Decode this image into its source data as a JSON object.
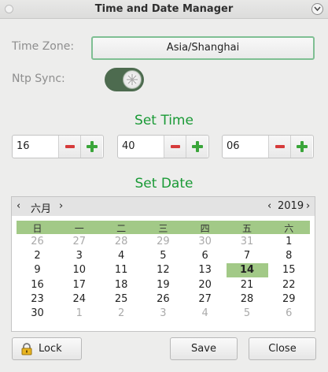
{
  "window": {
    "title": "Time and Date Manager"
  },
  "timezone": {
    "label": "Time Zone:",
    "value": "Asia/Shanghai"
  },
  "ntp": {
    "label": "Ntp Sync:",
    "enabled": true
  },
  "set_time": {
    "title": "Set Time",
    "hours": "16",
    "minutes": "40",
    "seconds": "06"
  },
  "set_date": {
    "title": "Set Date",
    "month": "六月",
    "year": "2019",
    "weekdays": [
      "日",
      "一",
      "二",
      "三",
      "四",
      "五",
      "六"
    ],
    "weeks": [
      [
        "26",
        "27",
        "28",
        "29",
        "30",
        "31",
        "1"
      ],
      [
        "2",
        "3",
        "4",
        "5",
        "6",
        "7",
        "8"
      ],
      [
        "9",
        "10",
        "11",
        "12",
        "13",
        "14",
        "15"
      ],
      [
        "16",
        "17",
        "18",
        "19",
        "20",
        "21",
        "22"
      ],
      [
        "23",
        "24",
        "25",
        "26",
        "27",
        "28",
        "29"
      ],
      [
        "30",
        "1",
        "2",
        "3",
        "4",
        "5",
        "6"
      ]
    ],
    "selected_day": "14"
  },
  "buttons": {
    "lock": "Lock",
    "save": "Save",
    "close": "Close"
  },
  "colors": {
    "accent_green": "#1a9a36",
    "calendar_highlight": "#a2c987",
    "minus_red": "#d63b3b",
    "plus_green": "#3aa53a"
  }
}
